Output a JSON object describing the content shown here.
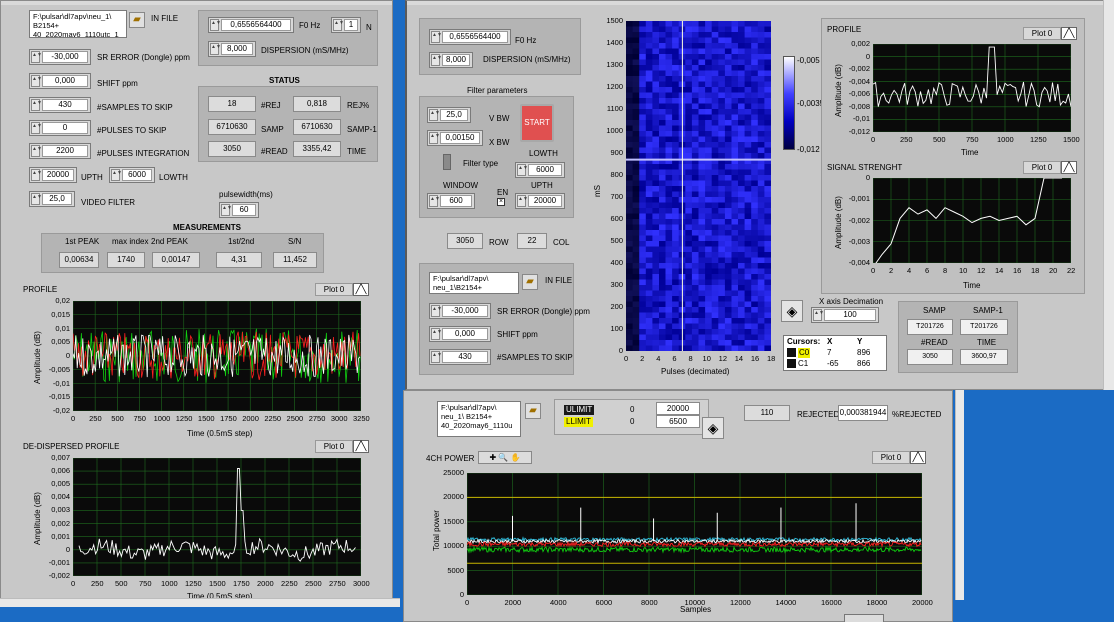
{
  "left": {
    "in_file_path": "F:\\pulsar\\dl7apv\\neu_1\\ B2154+ 40_2020may6_1110utc_1",
    "in_file_label": "IN FILE",
    "f0_value": "0,6556564400",
    "f0_label": "F0 Hz",
    "n_value": "1",
    "n_label": "N",
    "dispersion_value": "8,000",
    "dispersion_label": "DISPERSION (mS/MHz)",
    "sr_error_value": "-30,000",
    "sr_error_label": "SR ERROR (Dongle) ppm",
    "shift_value": "0,000",
    "shift_label": "SHIFT ppm",
    "samples_skip_value": "430",
    "samples_skip_label": "#SAMPLES TO SKIP",
    "pulses_skip_value": "0",
    "pulses_skip_label": "#PULSES TO SKIP",
    "pulses_int_value": "2200",
    "pulses_int_label": "#PULSES INTEGRATION",
    "upth_value": "20000",
    "upth_label": "UPTH",
    "lowth_value": "6000",
    "lowth_label": "LOWTH",
    "video_value": "25,0",
    "video_label": "VIDEO FILTER",
    "pulsewidth_label": "pulsewidth(ms)",
    "pulsewidth_value": "60",
    "status": {
      "title": "STATUS",
      "rej_value": "18",
      "rej_label": "#REJ",
      "rejpct_value": "0,818",
      "rejpct_label": "REJ%",
      "samp_value": "6710630",
      "samp_label": "SAMP",
      "samp1_value": "6710630",
      "samp1_label": "SAMP-1",
      "read_value": "3050",
      "read_label": "#READ",
      "time_value": "3355,42",
      "time_label": "TIME"
    },
    "measurements": {
      "title": "MEASUREMENTS",
      "peak1_label": "1st PEAK",
      "peak1_value": "0,00634",
      "maxidx_label": "max index",
      "maxidx_value": "1740",
      "peak2_label": "2nd PEAK",
      "peak2_value": "0,00147",
      "ratio_label": "1st/2nd",
      "ratio_value": "4,31",
      "sn_label": "S/N",
      "sn_value": "11,452"
    },
    "profile": {
      "title": "PROFILE",
      "plot_label": "Plot 0",
      "ylabel": "Amplitude (dB)",
      "xlabel": "Time (0.5mS step)",
      "yticks": [
        "0,02",
        "0,015",
        "0,01",
        "0,005",
        "0",
        "-0,005",
        "-0,01",
        "-0,015",
        "-0,02"
      ],
      "xticks": [
        "0",
        "250",
        "500",
        "750",
        "1000",
        "1250",
        "1500",
        "1750",
        "2000",
        "2250",
        "2500",
        "2750",
        "3000",
        "3250"
      ]
    },
    "dedispersed": {
      "title": "DE-DISPERSED PROFILE",
      "plot_label": "Plot 0",
      "ylabel": "Amplitude (dB)",
      "xlabel": "Time (0.5mS step)",
      "yticks": [
        "0,007",
        "0,006",
        "0,005",
        "0,004",
        "0,003",
        "0,002",
        "0,001",
        "0",
        "-0,001",
        "-0,002"
      ],
      "xticks": [
        "0",
        "250",
        "500",
        "750",
        "1000",
        "1250",
        "1500",
        "1750",
        "2000",
        "2250",
        "2500",
        "2750",
        "3000"
      ]
    }
  },
  "right": {
    "f0_value": "0,6556564400",
    "f0_label": "F0 Hz",
    "dispersion_value": "8,000",
    "dispersion_label": "DISPERSION (mS/MHz)",
    "filter_title": "Filter parameters",
    "vbw_value": "25,0",
    "vbw_label": "V BW",
    "xbw_value": "0,00150",
    "xbw_label": "X BW",
    "start_label": "START",
    "filtertype_label": "Filter type",
    "lowth_label": "LOWTH",
    "lowth_value": "6000",
    "upth_label": "UPTH",
    "upth_value": "20000",
    "window_label": "WINDOW",
    "window_value": "600",
    "en_label": "EN",
    "row_value": "3050",
    "row_label": "ROW",
    "col_value": "22",
    "col_label": "COL",
    "in_file_path": "F:\\pulsar\\dl7apv\\ neu_1\\B2154+",
    "in_file_label": "IN FILE",
    "sr_error_value": "-30,000",
    "sr_error_label": "SR ERROR (Dongle) ppm",
    "shift_value": "0,000",
    "shift_label": "SHIFT ppm",
    "samples_skip_value": "430",
    "samples_skip_label": "#SAMPLES TO SKIP",
    "waterfall": {
      "ylabel": "mS",
      "xlabel": "Pulses (decimated)",
      "yticks": [
        "1500",
        "1400",
        "1300",
        "1200",
        "1100",
        "1000",
        "900",
        "800",
        "700",
        "600",
        "500",
        "400",
        "300",
        "200",
        "100",
        "0"
      ],
      "xticks": [
        "0",
        "2",
        "4",
        "6",
        "8",
        "10",
        "12",
        "14",
        "16",
        "18"
      ]
    },
    "colorbar_ticks": [
      "-0,005",
      "-0,0035",
      "-0,012"
    ],
    "xdec_label": "X axis Decimation",
    "xdec_value": "100",
    "cursors": {
      "header": [
        "Cursors:",
        "X",
        "Y"
      ],
      "rows": [
        [
          "C0",
          "7",
          "896"
        ],
        [
          "C1",
          "-65",
          "866"
        ]
      ]
    },
    "samp_label": "SAMP",
    "samp_value": "T201726",
    "samp1_label": "SAMP-1",
    "samp1_value": "T201726",
    "read_label": "#READ",
    "read_value": "3050",
    "time_label": "TIME",
    "time_value": "3600,97",
    "profile": {
      "title": "PROFILE",
      "plot_label": "Plot 0",
      "ylabel": "Amplitude (dB)",
      "xlabel": "Time",
      "yticks": [
        "0,002",
        "0",
        "-0,002",
        "-0,004",
        "-0,006",
        "-0,008",
        "-0,01",
        "-0,012"
      ],
      "xticks": [
        "0",
        "250",
        "500",
        "750",
        "1000",
        "1250",
        "1500"
      ]
    },
    "signal": {
      "title": "SIGNAL STRENGHT",
      "plot_label": "Plot 0",
      "ylabel": "Amplitude (dB)",
      "xlabel": "Time",
      "yticks": [
        "0",
        "-0,001",
        "-0,002",
        "-0,003",
        "-0,004"
      ],
      "xticks": [
        "0",
        "2",
        "4",
        "6",
        "8",
        "10",
        "12",
        "14",
        "16",
        "18",
        "20",
        "22"
      ]
    }
  },
  "bottom": {
    "in_file_path": "F:\\pulsar\\dl7apv\\ neu_1\\ B2154+ 40_2020may6_1110u",
    "ulimit_label": "ULIMIT",
    "ulimit_a": "0",
    "ulimit_b": "20000",
    "llimit_label": "LLIMIT",
    "llimit_a": "0",
    "llimit_b": "6500",
    "rejected_value": "110",
    "rejected_label": "REJECTED",
    "pct_value": "0,000381944",
    "pct_label": "%REJECTED",
    "power": {
      "title": "4CH POWER",
      "plot_label": "Plot 0",
      "ylabel": "Total power",
      "xlabel": "Samples",
      "yticks": [
        "25000",
        "20000",
        "15000",
        "10000",
        "5000",
        "0"
      ],
      "xticks": [
        "0",
        "2000",
        "4000",
        "6000",
        "8000",
        "10000",
        "12000",
        "14000",
        "16000",
        "18000",
        "20000"
      ]
    }
  },
  "colors": {
    "panel": "#c8c8c8",
    "plot_bg": "#0a0a0a",
    "grid": "#1f6b1f",
    "trace_white": "#ffffff",
    "trace_red": "#ff2020",
    "trace_green": "#10d010",
    "limit_line": "#c8b400",
    "start_button": "#e05050",
    "desktop": "#1b6bc4",
    "cursor_highlight": "#f0f000"
  }
}
